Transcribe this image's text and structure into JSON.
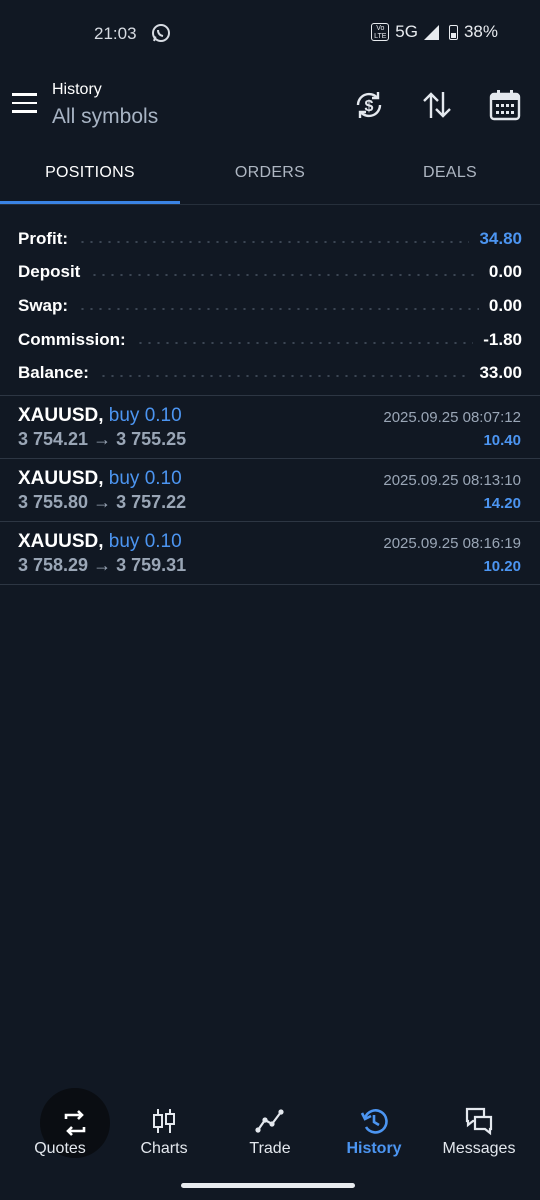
{
  "status": {
    "time": "21:03",
    "volte": "Vo LTE",
    "network": "5G",
    "battery": "38%"
  },
  "header": {
    "subtitle": "History",
    "title": "All symbols",
    "icons": [
      "currency-exchange-icon",
      "sort-icon",
      "calendar-icon"
    ]
  },
  "tabs": [
    {
      "label": "POSITIONS",
      "active": true
    },
    {
      "label": "ORDERS",
      "active": false
    },
    {
      "label": "DEALS",
      "active": false
    }
  ],
  "summary": [
    {
      "label": "Profit:",
      "value": "34.80",
      "accent": true
    },
    {
      "label": "Deposit",
      "value": "0.00"
    },
    {
      "label": "Swap:",
      "value": "0.00"
    },
    {
      "label": "Commission:",
      "value": "-1.80"
    },
    {
      "label": "Balance:",
      "value": "33.00"
    }
  ],
  "positions": [
    {
      "symbol": "XAUUSD,",
      "side": "buy 0.10",
      "open": "3 754.21",
      "arrow": "→",
      "close": "3 755.25",
      "time": "2025.09.25 08:07:12",
      "profit": "10.40"
    },
    {
      "symbol": "XAUUSD,",
      "side": "buy 0.10",
      "open": "3 755.80",
      "arrow": "→",
      "close": "3 757.22",
      "time": "2025.09.25 08:13:10",
      "profit": "14.20"
    },
    {
      "symbol": "XAUUSD,",
      "side": "buy 0.10",
      "open": "3 758.29",
      "arrow": "→",
      "close": "3 759.31",
      "time": "2025.09.25 08:16:19",
      "profit": "10.20"
    }
  ],
  "nav": [
    {
      "label": "Quotes",
      "icon": "quotes-icon"
    },
    {
      "label": "Charts",
      "icon": "candlestick-icon"
    },
    {
      "label": "Trade",
      "icon": "trade-line-icon"
    },
    {
      "label": "History",
      "icon": "history-icon",
      "active": true
    },
    {
      "label": "Messages",
      "icon": "messages-icon"
    }
  ],
  "colors": {
    "background": "#111823",
    "accent": "#4c95f1",
    "muted": "#9aa6b6"
  }
}
